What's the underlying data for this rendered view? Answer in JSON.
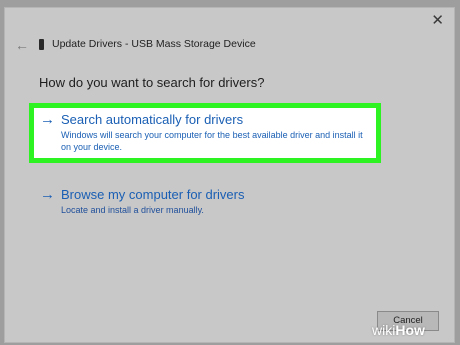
{
  "dialog": {
    "close_glyph": "✕",
    "back_glyph": "←",
    "title": "Update Drivers - USB Mass Storage Device",
    "heading": "How do you want to search for drivers?"
  },
  "options": [
    {
      "arrow": "→",
      "title": "Search automatically for drivers",
      "description": "Windows will search your computer for the best available driver and install it on your device."
    },
    {
      "arrow": "→",
      "title": "Browse my computer for drivers",
      "description": "Locate and install a driver manually."
    }
  ],
  "buttons": {
    "cancel": "Cancel"
  },
  "watermark": {
    "part1": "wiki",
    "part2": "How"
  },
  "colors": {
    "highlight_border": "#2cf321",
    "link_blue": "#1a5fb4"
  },
  "icons": [
    "close-icon",
    "back-arrow-icon",
    "usb-device-icon",
    "arrow-right-icon"
  ]
}
